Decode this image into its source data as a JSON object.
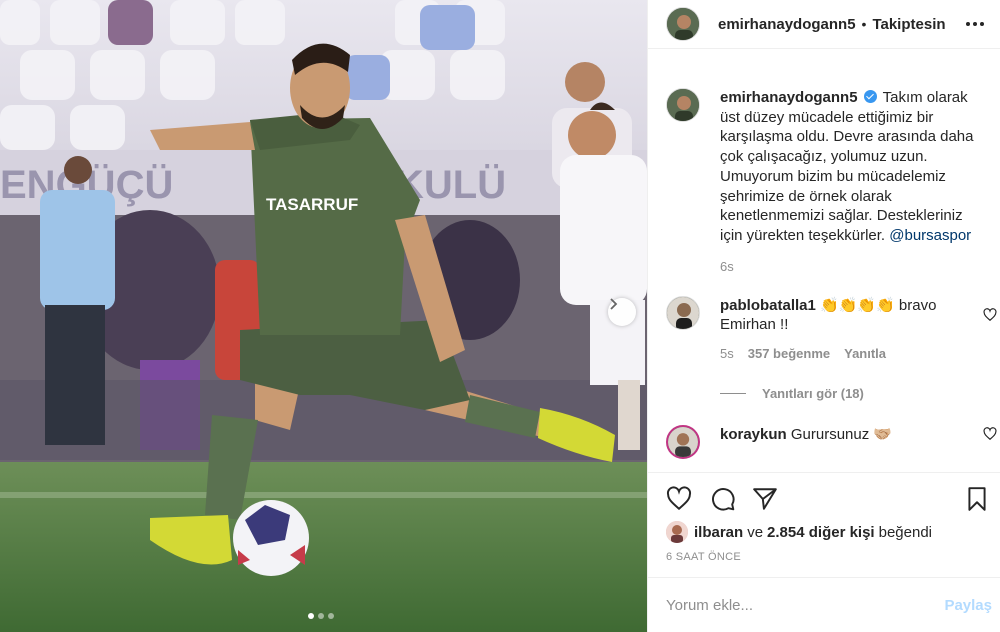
{
  "post": {
    "image_description_icon": "photo",
    "carousel_next_icon": "chevron-right-icon",
    "carousel": {
      "count": 3,
      "active": 0
    }
  },
  "header": {
    "username": "emirhanaydogann5",
    "separator": "•",
    "follow_label": "Takiptesin",
    "more_icon": "more-horizontal-icon"
  },
  "caption": {
    "username": "emirhanaydogann5",
    "verified": true,
    "text": "Takım olarak üst düzey mücadele ettiğimiz bir karşılaşma oldu. Devre arasında daha çok çalışacağız, yolumuz uzun. Umuyorum bizim bu mücadelemiz şehrimize de örnek olarak kenetlenmemizi sağlar. Destekleriniz için yürekten teşekkürler.",
    "mention": "@bursaspor",
    "time": "6s"
  },
  "comments": [
    {
      "username": "pablobatalla1",
      "text": "👏👏👏👏 bravo Emirhan !!",
      "time": "5s",
      "likes": "357 beğenme",
      "reply_label": "Yanıtla",
      "view_replies": "Yanıtları gör (18)"
    },
    {
      "username": "koraykun",
      "text": "Gurursunuz 🤝🏼"
    }
  ],
  "likes": {
    "first_user": "ilbaran",
    "connector": "ve",
    "others": "2.854 diğer kişi",
    "suffix": "beğendi"
  },
  "time_ago": "6 SAAT ÖNCE",
  "add_comment": {
    "placeholder": "Yorum ekle...",
    "post_label": "Paylaş"
  },
  "colors": {
    "accent_blue": "#3897f0",
    "post_disabled": "#b3dbff",
    "secondary_text": "#8e8e8e"
  }
}
